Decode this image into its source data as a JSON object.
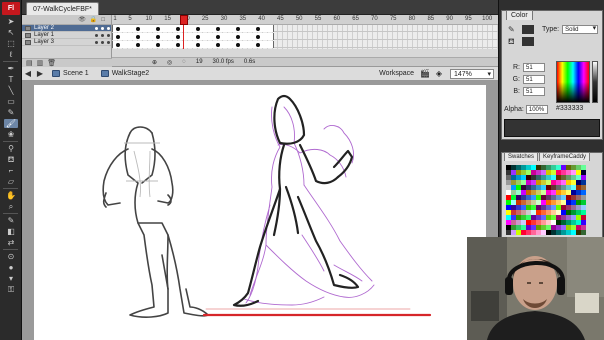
{
  "app": {
    "logo": "Fl"
  },
  "document": {
    "tab_title": "07-WalkCycleFBF*"
  },
  "timeline": {
    "ruler_ticks": [
      "1",
      "5",
      "10",
      "15",
      "20",
      "25",
      "30",
      "35",
      "40",
      "45",
      "50",
      "55",
      "60",
      "65",
      "70",
      "75",
      "80",
      "85",
      "90",
      "95",
      "100"
    ],
    "layers": [
      {
        "name": "Layer 2",
        "selected": true
      },
      {
        "name": "Layer 1",
        "selected": false
      },
      {
        "name": "Layer 3",
        "selected": false
      }
    ],
    "current_frame": "19",
    "frame_rate": "30.0 fps",
    "elapsed_time": "0.6s"
  },
  "editbar": {
    "scene": "Scene 1",
    "symbol": "WalkStage2",
    "workspace": "Workspace",
    "zoom": "147%"
  },
  "color_panel": {
    "tab": "Color",
    "type_label": "Type:",
    "type_value": "Solid",
    "r_label": "R:",
    "r": "51",
    "g_label": "G:",
    "g": "51",
    "b_label": "B:",
    "b": "51",
    "alpha_label": "Alpha:",
    "alpha": "100%",
    "hex": "#333333"
  },
  "swatches_panel": {
    "tabs": [
      "Swatches",
      "KeyframeCaddy"
    ]
  },
  "colors": {
    "stroke": "#333333",
    "onion_skin": "#b06ad0",
    "ground_line": "#d6262a",
    "accent": "#c4171d"
  }
}
